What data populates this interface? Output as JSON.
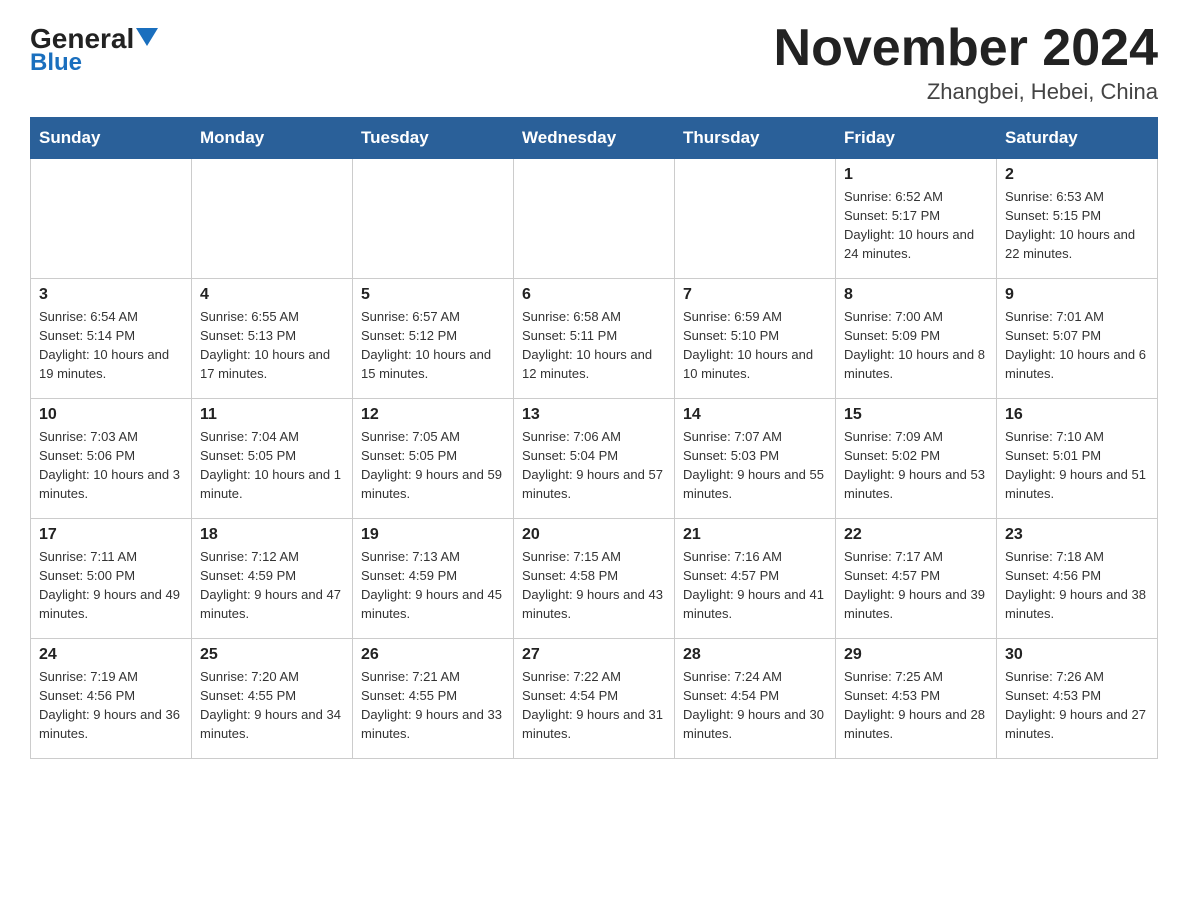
{
  "header": {
    "logo_general": "General",
    "logo_blue": "Blue",
    "month_title": "November 2024",
    "location": "Zhangbei, Hebei, China"
  },
  "days_of_week": [
    "Sunday",
    "Monday",
    "Tuesday",
    "Wednesday",
    "Thursday",
    "Friday",
    "Saturday"
  ],
  "weeks": [
    [
      {
        "day": "",
        "info": ""
      },
      {
        "day": "",
        "info": ""
      },
      {
        "day": "",
        "info": ""
      },
      {
        "day": "",
        "info": ""
      },
      {
        "day": "",
        "info": ""
      },
      {
        "day": "1",
        "info": "Sunrise: 6:52 AM\nSunset: 5:17 PM\nDaylight: 10 hours and 24 minutes."
      },
      {
        "day": "2",
        "info": "Sunrise: 6:53 AM\nSunset: 5:15 PM\nDaylight: 10 hours and 22 minutes."
      }
    ],
    [
      {
        "day": "3",
        "info": "Sunrise: 6:54 AM\nSunset: 5:14 PM\nDaylight: 10 hours and 19 minutes."
      },
      {
        "day": "4",
        "info": "Sunrise: 6:55 AM\nSunset: 5:13 PM\nDaylight: 10 hours and 17 minutes."
      },
      {
        "day": "5",
        "info": "Sunrise: 6:57 AM\nSunset: 5:12 PM\nDaylight: 10 hours and 15 minutes."
      },
      {
        "day": "6",
        "info": "Sunrise: 6:58 AM\nSunset: 5:11 PM\nDaylight: 10 hours and 12 minutes."
      },
      {
        "day": "7",
        "info": "Sunrise: 6:59 AM\nSunset: 5:10 PM\nDaylight: 10 hours and 10 minutes."
      },
      {
        "day": "8",
        "info": "Sunrise: 7:00 AM\nSunset: 5:09 PM\nDaylight: 10 hours and 8 minutes."
      },
      {
        "day": "9",
        "info": "Sunrise: 7:01 AM\nSunset: 5:07 PM\nDaylight: 10 hours and 6 minutes."
      }
    ],
    [
      {
        "day": "10",
        "info": "Sunrise: 7:03 AM\nSunset: 5:06 PM\nDaylight: 10 hours and 3 minutes."
      },
      {
        "day": "11",
        "info": "Sunrise: 7:04 AM\nSunset: 5:05 PM\nDaylight: 10 hours and 1 minute."
      },
      {
        "day": "12",
        "info": "Sunrise: 7:05 AM\nSunset: 5:05 PM\nDaylight: 9 hours and 59 minutes."
      },
      {
        "day": "13",
        "info": "Sunrise: 7:06 AM\nSunset: 5:04 PM\nDaylight: 9 hours and 57 minutes."
      },
      {
        "day": "14",
        "info": "Sunrise: 7:07 AM\nSunset: 5:03 PM\nDaylight: 9 hours and 55 minutes."
      },
      {
        "day": "15",
        "info": "Sunrise: 7:09 AM\nSunset: 5:02 PM\nDaylight: 9 hours and 53 minutes."
      },
      {
        "day": "16",
        "info": "Sunrise: 7:10 AM\nSunset: 5:01 PM\nDaylight: 9 hours and 51 minutes."
      }
    ],
    [
      {
        "day": "17",
        "info": "Sunrise: 7:11 AM\nSunset: 5:00 PM\nDaylight: 9 hours and 49 minutes."
      },
      {
        "day": "18",
        "info": "Sunrise: 7:12 AM\nSunset: 4:59 PM\nDaylight: 9 hours and 47 minutes."
      },
      {
        "day": "19",
        "info": "Sunrise: 7:13 AM\nSunset: 4:59 PM\nDaylight: 9 hours and 45 minutes."
      },
      {
        "day": "20",
        "info": "Sunrise: 7:15 AM\nSunset: 4:58 PM\nDaylight: 9 hours and 43 minutes."
      },
      {
        "day": "21",
        "info": "Sunrise: 7:16 AM\nSunset: 4:57 PM\nDaylight: 9 hours and 41 minutes."
      },
      {
        "day": "22",
        "info": "Sunrise: 7:17 AM\nSunset: 4:57 PM\nDaylight: 9 hours and 39 minutes."
      },
      {
        "day": "23",
        "info": "Sunrise: 7:18 AM\nSunset: 4:56 PM\nDaylight: 9 hours and 38 minutes."
      }
    ],
    [
      {
        "day": "24",
        "info": "Sunrise: 7:19 AM\nSunset: 4:56 PM\nDaylight: 9 hours and 36 minutes."
      },
      {
        "day": "25",
        "info": "Sunrise: 7:20 AM\nSunset: 4:55 PM\nDaylight: 9 hours and 34 minutes."
      },
      {
        "day": "26",
        "info": "Sunrise: 7:21 AM\nSunset: 4:55 PM\nDaylight: 9 hours and 33 minutes."
      },
      {
        "day": "27",
        "info": "Sunrise: 7:22 AM\nSunset: 4:54 PM\nDaylight: 9 hours and 31 minutes."
      },
      {
        "day": "28",
        "info": "Sunrise: 7:24 AM\nSunset: 4:54 PM\nDaylight: 9 hours and 30 minutes."
      },
      {
        "day": "29",
        "info": "Sunrise: 7:25 AM\nSunset: 4:53 PM\nDaylight: 9 hours and 28 minutes."
      },
      {
        "day": "30",
        "info": "Sunrise: 7:26 AM\nSunset: 4:53 PM\nDaylight: 9 hours and 27 minutes."
      }
    ]
  ]
}
